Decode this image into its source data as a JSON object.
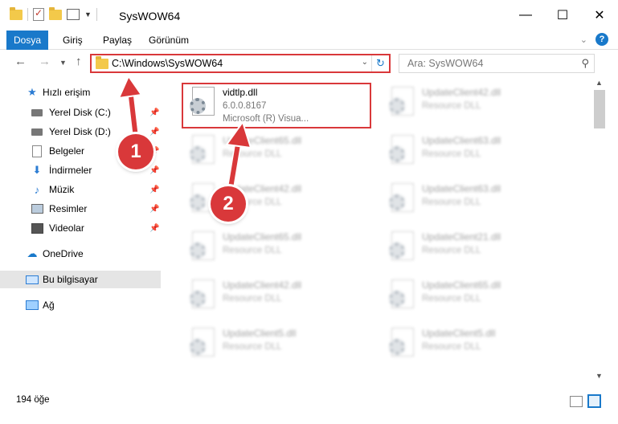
{
  "window": {
    "title": "SysWOW64",
    "minimize": "—",
    "maximize": "☐",
    "close": "✕"
  },
  "ribbon": {
    "tabs": [
      "Dosya",
      "Giriş",
      "Paylaş",
      "Görünüm"
    ],
    "help": "?"
  },
  "nav": {
    "back": "←",
    "forward": "→",
    "up": "↑",
    "address": "C:\\Windows\\SysWOW64",
    "search_placeholder": "Ara: SysWOW64"
  },
  "sidebar": {
    "quick_access": "Hızlı erişim",
    "items": [
      {
        "label": "Yerel Disk (C:)",
        "icon": "drive-icon",
        "pinned": true
      },
      {
        "label": "Yerel Disk (D:)",
        "icon": "drive-icon",
        "pinned": true
      },
      {
        "label": "Belgeler",
        "icon": "documents-icon",
        "pinned": true
      },
      {
        "label": "İndirmeler",
        "icon": "downloads-icon",
        "pinned": true
      },
      {
        "label": "Müzik",
        "icon": "music-icon",
        "pinned": true
      },
      {
        "label": "Resimler",
        "icon": "pictures-icon",
        "pinned": true
      },
      {
        "label": "Videolar",
        "icon": "videos-icon",
        "pinned": true
      }
    ],
    "onedrive": "OneDrive",
    "this_pc": "Bu bilgisayar",
    "network": "Ağ"
  },
  "files": [
    {
      "name": "vidtlp.dll",
      "meta1": "6.0.0.8167",
      "meta2": "Microsoft (R) Visua...",
      "highlighted": true
    },
    {
      "name": "UpdateClient42.dll",
      "meta1": "Resource DLL"
    },
    {
      "name": "UpdateClient65.dll",
      "meta1": "Resource DLL"
    },
    {
      "name": "UpdateClient63.dll",
      "meta1": "Resource DLL"
    },
    {
      "name": "UpdateClient42.dll",
      "meta1": "Resource DLL"
    },
    {
      "name": "UpdateClient63.dll",
      "meta1": "Resource DLL"
    },
    {
      "name": "UpdateClient65.dll",
      "meta1": "Resource DLL"
    },
    {
      "name": "UpdateClient21.dll",
      "meta1": "Resource DLL"
    },
    {
      "name": "UpdateClient42.dll",
      "meta1": "Resource DLL"
    },
    {
      "name": "UpdateClient65.dll",
      "meta1": "Resource DLL"
    },
    {
      "name": "UpdateClient5.dll",
      "meta1": "Resource DLL"
    },
    {
      "name": "UpdateClient5.dll",
      "meta1": "Resource DLL"
    }
  ],
  "status": {
    "count": "194 öğe"
  },
  "annotations": {
    "step1": "1",
    "step2": "2",
    "color": "#d9383a"
  }
}
